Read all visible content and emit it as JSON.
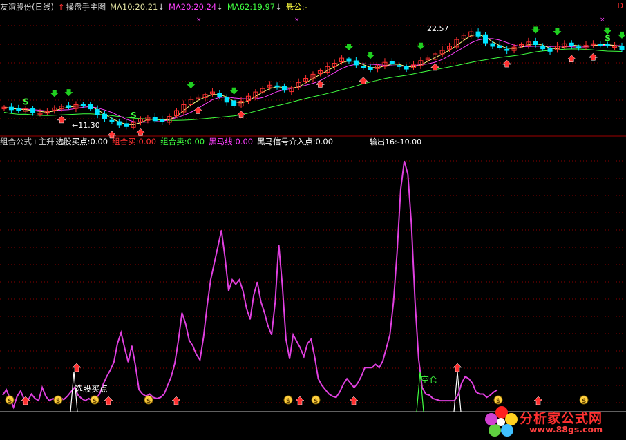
{
  "top_header": {
    "stock": "友谊股份(日线)",
    "main_chart": "操盘手主图",
    "ma10": "MA10:20.21",
    "ma20": "MA20:20.24",
    "ma62": "MA62:19.97",
    "hangong": "悬公:-",
    "corner": "D"
  },
  "top_annotations": {
    "high_price": "22.57",
    "low_price": "←11.30"
  },
  "indicator_header": {
    "name": "组合公式+主升",
    "xuangu": "选股买点:0.00",
    "zuhe_mai": "组合买:0.00",
    "zuhe_sell": "组合卖:0.00",
    "heima_line": "黑马线:0.00",
    "heima_signal": "黑马信号介入点:0.00",
    "output": "输出16:-10.00"
  },
  "indicator_annotations": {
    "xuangu_label": "选股买点",
    "kongcang": "空仓"
  },
  "watermark": {
    "site_name": "分析家公式网",
    "site_url": "www.88gs.com"
  },
  "colors": {
    "background": "#000000",
    "grid": "#8b0000",
    "separator": "#a00000",
    "candle_up": "#ff3030",
    "candle_down": "#00e5ff",
    "ma_yellow": "#ffff80",
    "ma_pink": "#ff40ff",
    "ma_green": "#40ff40",
    "indicator_line": "#e040e0",
    "arrow_up": "#ff3030",
    "arrow_down": "#20d020"
  },
  "chart_data": [
    {
      "type": "candlestick",
      "title": "友谊股份(日线)",
      "series": [
        {
          "name": "MA10",
          "value": 20.21
        },
        {
          "name": "MA20",
          "value": 20.24
        },
        {
          "name": "MA62",
          "value": 19.97
        }
      ],
      "annotations": [
        "22.57",
        "←11.30"
      ],
      "close": [
        13.6,
        13.3,
        13.2,
        13.4,
        13.0,
        12.9,
        13.1,
        13.5,
        13.7,
        13.6,
        13.9,
        13.8,
        13.4,
        12.7,
        12.2,
        11.9,
        11.5,
        11.3,
        11.8,
        12.2,
        12.4,
        12.0,
        11.9,
        12.5,
        13.2,
        13.9,
        14.5,
        14.8,
        15.1,
        15.4,
        14.8,
        14.2,
        13.8,
        14.3,
        14.9,
        15.4,
        15.8,
        16.2,
        16.0,
        15.6,
        15.9,
        16.5,
        17.0,
        17.5,
        17.9,
        18.4,
        18.8,
        19.4,
        19.0,
        18.6,
        18.3,
        18.0,
        18.5,
        18.9,
        18.7,
        18.4,
        18.1,
        18.6,
        19.1,
        19.4,
        19.9,
        20.3,
        20.8,
        21.6,
        22.1,
        22.5,
        22.0,
        21.2,
        20.8,
        20.6,
        20.3,
        20.7,
        21.0,
        21.3,
        21.0,
        20.5,
        20.2,
        20.8,
        21.1,
        20.9,
        20.6,
        20.9,
        21.1,
        21.0,
        20.9,
        20.8,
        20.4
      ]
    },
    {
      "type": "line",
      "title": "组合公式+主升",
      "series": [
        {
          "name": "输出16",
          "values": [
            0.5,
            1.0,
            0.2,
            -0.6,
            0.4,
            0.9,
            0.1,
            0.0,
            0.6,
            0.2,
            0.0,
            1.2,
            0.4,
            0.0,
            0.2,
            0.0,
            0.3,
            0.1,
            0.4,
            0.8,
            1.2,
            0.5,
            0.2,
            0.0,
            0.2,
            0.0,
            0.2,
            0.6,
            1.5,
            2.2,
            2.8,
            3.5,
            5.2,
            6.2,
            4.8,
            3.5,
            5.0,
            3.2,
            1.0,
            0.6,
            0.4,
            0.6,
            0.3,
            0.2,
            0.3,
            0.6,
            1.4,
            2.2,
            3.4,
            5.5,
            8.0,
            7.0,
            5.5,
            5.0,
            4.2,
            3.7,
            5.8,
            8.6,
            11.0,
            12.5,
            14.0,
            15.5,
            13.0,
            10.0,
            11.0,
            10.6,
            11.0,
            10.0,
            8.4,
            7.4,
            9.6,
            10.8,
            9.0,
            8.0,
            6.8,
            6.0,
            9.0,
            14.2,
            10.4,
            5.6,
            3.8,
            6.0,
            5.4,
            4.8,
            4.0,
            5.2,
            5.6,
            4.0,
            2.0,
            1.4,
            1.0,
            0.6,
            0.4,
            0.3,
            0.8,
            1.5,
            2.0,
            1.6,
            1.2,
            1.6,
            2.2,
            3.0,
            3.0,
            3.0,
            3.3,
            3.0,
            3.6,
            4.8,
            6.0,
            9.0,
            13.5,
            19.2,
            21.8,
            20.6,
            16.0,
            9.0,
            3.8,
            1.2,
            0.6,
            0.5,
            0.2,
            0.1,
            0.0,
            0.0,
            0.0,
            0.0,
            0.0,
            0.5,
            1.6,
            2.2,
            2.0,
            1.6,
            0.8,
            0.6,
            0.6,
            0.3,
            0.5,
            0.8,
            1.0
          ]
        }
      ]
    }
  ]
}
